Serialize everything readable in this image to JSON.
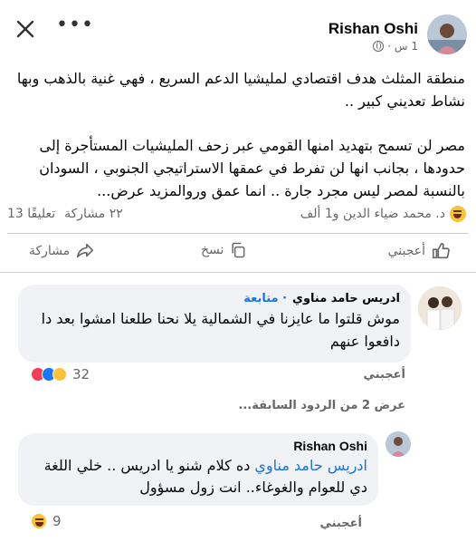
{
  "header": {
    "author": "Rishan Oshi",
    "time": "1 س ·"
  },
  "post": {
    "paragraph1": "منطقة المثلث هدف اقتصادي لمليشيا الدعم السريع ، فهي غنية بالذهب وبها نشاط تعديني كبير ..",
    "paragraph2": "مصر لن تسمح بتهديد امنها القومي عبر زحف المليشيات المستأجرة إلى حدودها ، بجانب انها لن تفرط في عمقها الاستراتيجي الجنوبي ، السودان بالنسبة لمصر ليس مجرد جارة .. انما عمق وروالمزيد",
    "see_more": "عرض..."
  },
  "stats": {
    "reactions_text": "د. محمد ضياء الدين و1 ألف",
    "comments": "13 تعليقًا",
    "shares": "٢٢ مشاركة"
  },
  "actions": {
    "like": "أعجبني",
    "copy": "نسخ",
    "share": "مشاركة"
  },
  "comment1": {
    "name": "ادريس حامد مناوي",
    "follow": "· متابعة",
    "text": "موش قلتوا ما عايزنا في الشمالية يلا نحنا طلعنا امشوا بعد دا دافعوا عنهم",
    "reaction_count": "32",
    "like": "أعجبني"
  },
  "more_replies": "عرض 2 من الردود السابقة...",
  "comment2": {
    "name": "Rishan Oshi",
    "mention": "ادريس حامد مناوي",
    "text": "ده كلام شنو يا ادريس .. خلي اللغة دي للعوام والغوغاء.. انت زول مسؤول",
    "reaction_count": "9",
    "like": "أعجبني"
  },
  "icons": {
    "close": "close-icon",
    "more": "more-icon",
    "globe": "globe-icon",
    "like": "like-icon",
    "copy": "copy-icon",
    "share": "share-icon"
  },
  "colors": {
    "link": "#1b74e4",
    "secondary": "#65676b",
    "bubble": "#f0f2f5"
  }
}
